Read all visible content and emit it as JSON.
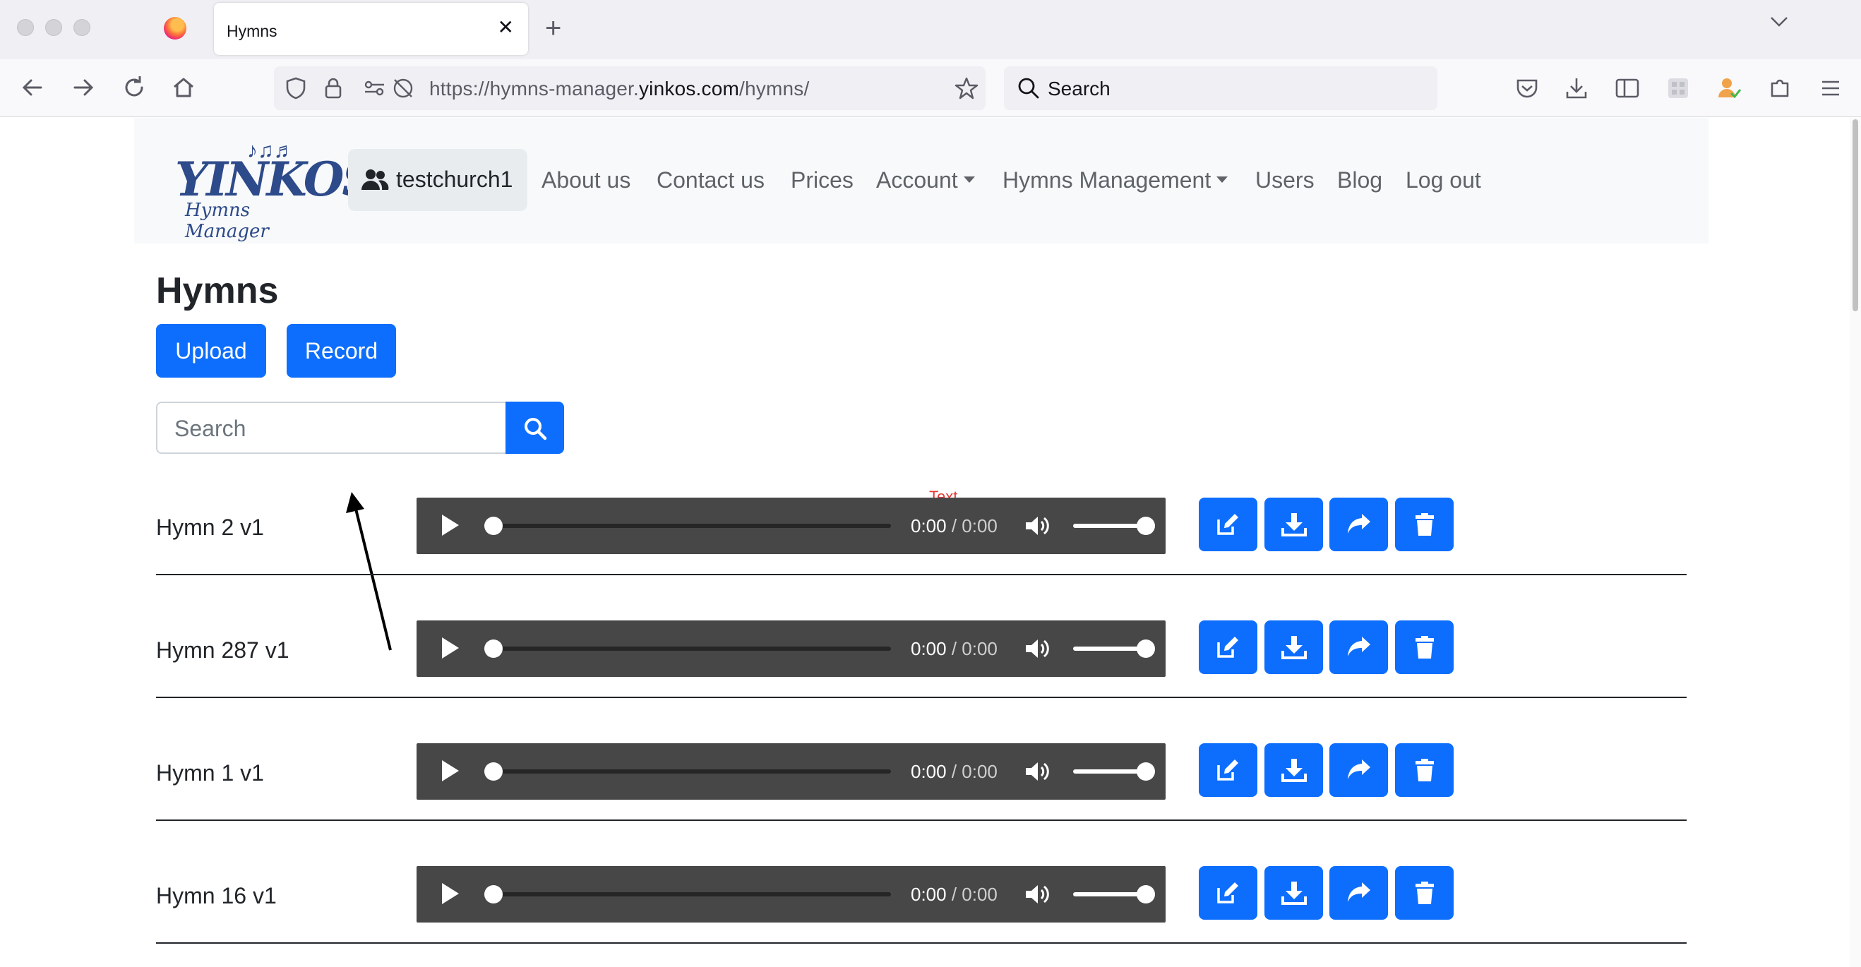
{
  "browser": {
    "tab_title": "Hymns",
    "tab_close": "✕",
    "new_tab": "+",
    "url_prefix": "https://hymns-manager.",
    "url_domain": "yinkos.com",
    "url_path": "/hymns/",
    "search_placeholder": "Search"
  },
  "site": {
    "logo_word": "YINKOS",
    "logo_sub": "Hymns Manager",
    "logo_notes": "♪♫♬",
    "user": "testchurch1",
    "nav": {
      "about": "About us",
      "contact": "Contact us",
      "prices": "Prices",
      "account": "Account",
      "hymns_mgmt": "Hymns Management",
      "users": "Users",
      "blog": "Blog",
      "logout": "Log out"
    }
  },
  "main": {
    "title": "Hymns",
    "upload_label": "Upload",
    "record_label": "Record",
    "search_placeholder": "Search",
    "annotation": "Text"
  },
  "hymns": [
    {
      "name": "Hymn 2 v1",
      "current": "0:00",
      "total": "0:00"
    },
    {
      "name": "Hymn 287 v1",
      "current": "0:00",
      "total": "0:00"
    },
    {
      "name": "Hymn 1 v1",
      "current": "0:00",
      "total": "0:00"
    },
    {
      "name": "Hymn 16 v1",
      "current": "0:00",
      "total": "0:00"
    }
  ],
  "time_separator": " / ",
  "colors": {
    "primary": "#0d6efd",
    "player": "#474747",
    "annotation": "#e53935"
  }
}
